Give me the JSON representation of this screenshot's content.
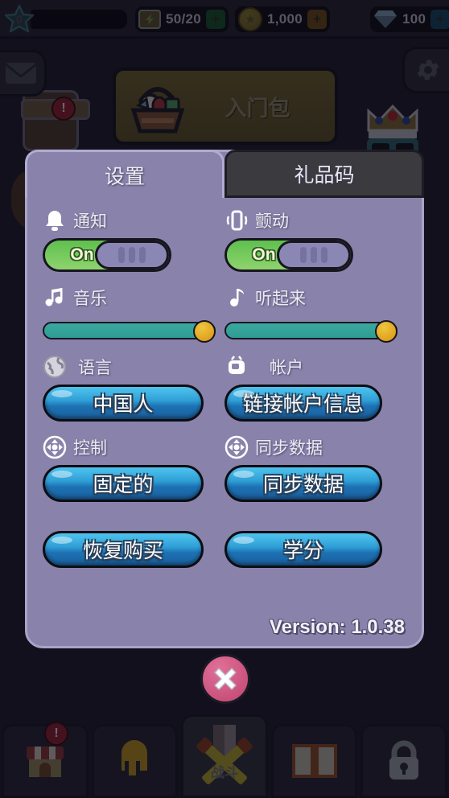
{
  "topbar": {
    "level": "0",
    "resources": [
      {
        "name": "energy",
        "icon": "energy-icon",
        "value": "50/20",
        "add_label": "+"
      },
      {
        "name": "gold",
        "icon": "coin-icon",
        "value": "1,000",
        "add_label": "+"
      },
      {
        "name": "gem",
        "icon": "gem-icon",
        "value": "100",
        "add_label": "+"
      }
    ]
  },
  "background": {
    "mail_icon": "mail-icon",
    "gear_icon": "gear-icon",
    "quest_badge": "!",
    "shop_badge": "!",
    "pack": {
      "label": "入门包",
      "icon": "basket-icon"
    }
  },
  "dialog": {
    "tabs": [
      {
        "label": "设置",
        "active": true
      },
      {
        "label": "礼品码",
        "active": false
      }
    ],
    "notification": {
      "icon": "bell-icon",
      "label": "通知",
      "state": "On"
    },
    "vibration": {
      "icon": "phone-vibrate-icon",
      "label": "颤动",
      "state": "On"
    },
    "music": {
      "icon": "music-notes-icon",
      "label": "音乐",
      "value": 100
    },
    "sound": {
      "icon": "music-note-icon",
      "label": "听起来",
      "value": 100
    },
    "language": {
      "icon": "globe-icon",
      "label": "语言",
      "button": "中国人"
    },
    "account": {
      "icon": "tv-icon",
      "label": "帐户",
      "button": "链接帐户信息"
    },
    "control": {
      "icon": "dpad-icon",
      "label": "控制",
      "button": "固定的"
    },
    "sync": {
      "icon": "dpad-icon",
      "label": "同步数据",
      "button": "同步数据"
    },
    "restore_button": "恢复购买",
    "credits_button": "学分",
    "version": "Version: 1.0.38",
    "close_icon": "close-icon"
  },
  "bottomnav": [
    {
      "name": "shop",
      "icon": "shop-icon",
      "label": "",
      "active": false
    },
    {
      "name": "hero",
      "icon": "helmet-icon",
      "label": "",
      "active": false
    },
    {
      "name": "battle",
      "icon": "swords-icon",
      "label": "战斗",
      "active": true
    },
    {
      "name": "book",
      "icon": "book-icon",
      "label": "",
      "active": false
    },
    {
      "name": "locked",
      "icon": "lock-icon",
      "label": "",
      "active": false
    }
  ],
  "colors": {
    "panel": "#8983ab",
    "button_blue": "#2f9fd6",
    "toggle_on": "#5fc04e",
    "slider_fill": "#2f9c93",
    "close": "#c0456f"
  }
}
